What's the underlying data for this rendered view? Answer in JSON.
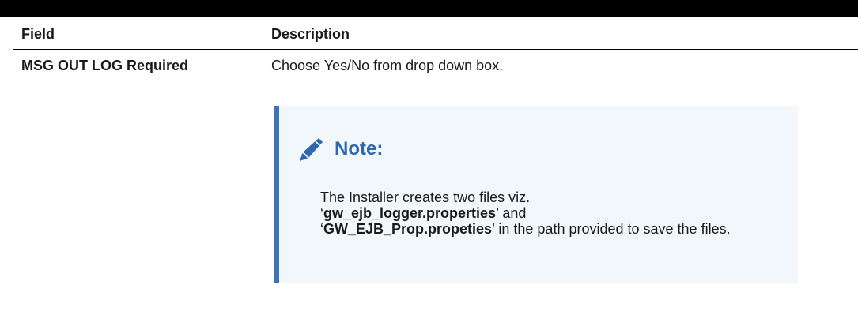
{
  "table": {
    "headers": {
      "field": "Field",
      "description": "Description"
    },
    "rows": [
      {
        "field": "MSG OUT LOG Required",
        "description": "Choose Yes/No from drop down box."
      }
    ]
  },
  "note": {
    "icon": "pencil-icon",
    "title": "Note:",
    "line1": "The Installer creates two files viz.",
    "quote_open": "‘",
    "quote_close": "’",
    "file1": "gw_ejb_logger.properties",
    "and_text": " and",
    "file2": "GW_EJB_Prop.propeties",
    "rest": " in the path provided to save the files."
  },
  "colors": {
    "note_accent": "#3d73b9",
    "note_background": "#f1f7fb",
    "note_title": "#2f68ae"
  }
}
